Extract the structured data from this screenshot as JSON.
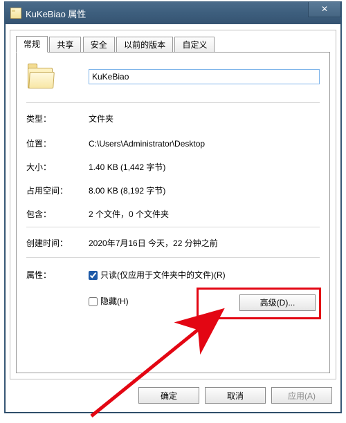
{
  "window": {
    "title": "KuKeBiao 属性"
  },
  "tabs": {
    "general": "常规",
    "sharing": "共享",
    "security": "安全",
    "previous": "以前的版本",
    "customize": "自定义"
  },
  "folder_name": "KuKeBiao",
  "rows": {
    "type_label": "类型：",
    "type_value": "文件夹",
    "location_label": "位置：",
    "location_value": "C:\\Users\\Administrator\\Desktop",
    "size_label": "大小：",
    "size_value": "1.40 KB (1,442 字节)",
    "size_on_disk_label": "占用空间：",
    "size_on_disk_value": "8.00 KB (8,192 字节)",
    "contains_label": "包含：",
    "contains_value": "2 个文件，0 个文件夹",
    "created_label": "创建时间：",
    "created_value": "2020年7月16日 今天，22 分钟之前",
    "attributes_label": "属性："
  },
  "checkboxes": {
    "readonly_label": "只读(仅应用于文件夹中的文件)(R)",
    "readonly_checked": true,
    "hidden_label": "隐藏(H)",
    "hidden_checked": false
  },
  "buttons": {
    "advanced": "高级(D)...",
    "ok": "确定",
    "cancel": "取消",
    "apply": "应用(A)"
  }
}
